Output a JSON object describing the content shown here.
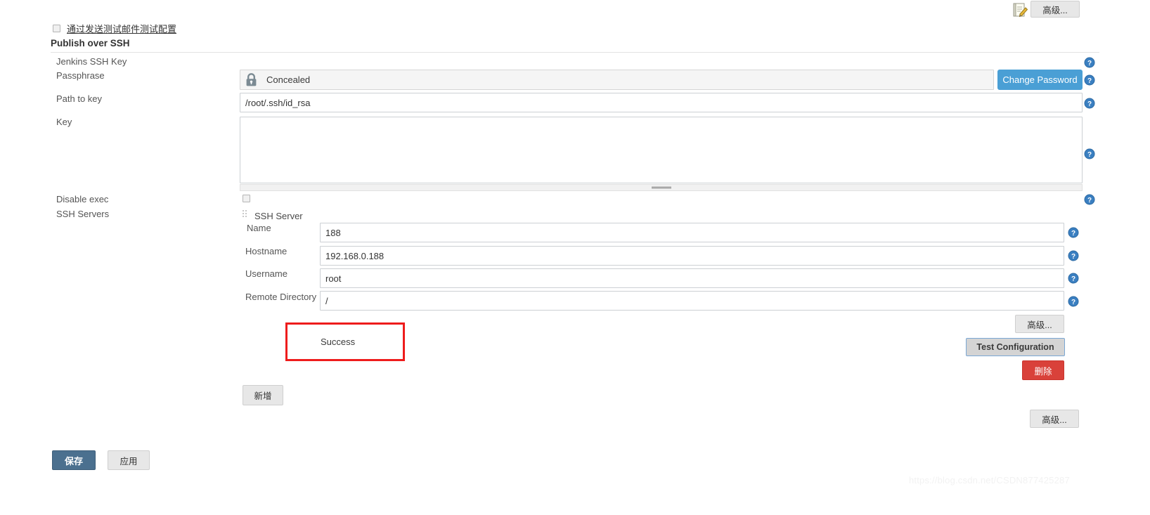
{
  "topbar": {
    "edit_icon": "notepad-edit-icon",
    "advanced_label": "高级..."
  },
  "test_mail": {
    "label": "通过发送测试邮件测试配置",
    "checked": false
  },
  "section": {
    "title": "Publish over SSH"
  },
  "fields": {
    "jenkins_ssh_key_label": "Jenkins SSH Key",
    "passphrase_label": "Passphrase",
    "passphrase_value": "Concealed",
    "change_password_label": "Change Password",
    "path_to_key_label": "Path to key",
    "path_to_key_value": "/root/.ssh/id_rsa",
    "key_label": "Key",
    "key_value": "",
    "disable_exec_label": "Disable exec",
    "ssh_servers_label": "SSH Servers"
  },
  "ssh_server": {
    "heading": "SSH Server",
    "rows": [
      {
        "label": "Name",
        "value": "188"
      },
      {
        "label": "Hostname",
        "value": "192.168.0.188"
      },
      {
        "label": "Username",
        "value": "root"
      },
      {
        "label": "Remote Directory",
        "value": "/"
      }
    ],
    "advanced_label": "高级...",
    "test_configuration_label": "Test Configuration",
    "delete_label": "删除",
    "result_text": "Success"
  },
  "buttons": {
    "add_label": "新增",
    "bottom_advanced_label": "高级...",
    "save_label": "保存",
    "apply_label": "应用"
  },
  "icons": {
    "lock": "lock-icon",
    "help": "help-icon",
    "drag_handle": "drag-handle-icon"
  },
  "colors": {
    "accent_blue": "#4a9fd5",
    "save_blue": "#4b708f",
    "delete_red": "#d9413a",
    "annotation_red": "#ee1c1c",
    "help_blue": "#3a7fc1"
  },
  "watermark": {
    "text": "https://blog.csdn.net/CSDN877425287"
  }
}
